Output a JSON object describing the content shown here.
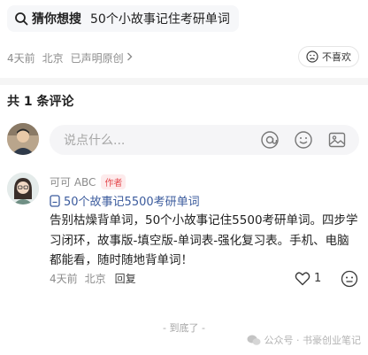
{
  "search": {
    "guess_label": "猜你想搜",
    "query": "50个小故事记住考研单词"
  },
  "article_meta": {
    "time": "4天前",
    "location": "北京",
    "declaration": "已声明原创",
    "dislike_label": "不喜欢"
  },
  "comments": {
    "count_label": "共 1 条评论",
    "input_placeholder": "说点什么...",
    "items": [
      {
        "username": "可可 ABC",
        "author_tag": "作者",
        "linked_note": "50个故事记5500考研单词",
        "text": "告别枯燥背单词，50个小故事记住5500考研单词。四步学习闭环，故事版-填空版-单词表-强化复习表。手机、电脑都能看，随时随地背单词！",
        "time": "4天前",
        "location": "北京",
        "reply_label": "回复",
        "likes": "1"
      }
    ]
  },
  "end_label": "- 到底了 -",
  "watermark": "公众号 · 书豪创业笔记",
  "colors": {
    "link": "#3b5b9d",
    "author_tag": "#e5484d",
    "input_bg": "#f5f5f7"
  },
  "icons": [
    "search-icon",
    "chevron-right-icon",
    "sad-face-icon",
    "at-icon",
    "smile-icon",
    "image-icon",
    "note-icon",
    "heart-icon",
    "wechat-icon"
  ]
}
